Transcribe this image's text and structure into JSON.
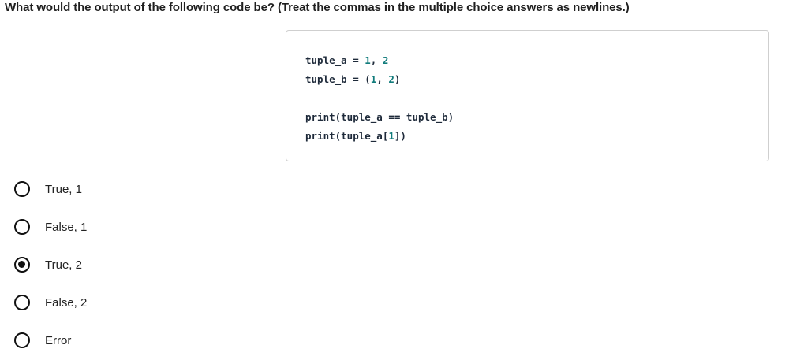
{
  "question": "What would the output of the following code be? (Treat the commas in the multiple choice answers as newlines.)",
  "code_lines": [
    [
      {
        "t": "tuple_a = ",
        "k": "text"
      },
      {
        "t": "1",
        "k": "num"
      },
      {
        "t": ", ",
        "k": "text"
      },
      {
        "t": "2",
        "k": "num"
      }
    ],
    [
      {
        "t": "tuple_b = (",
        "k": "text"
      },
      {
        "t": "1",
        "k": "num"
      },
      {
        "t": ", ",
        "k": "text"
      },
      {
        "t": "2",
        "k": "num"
      },
      {
        "t": ")",
        "k": "text"
      }
    ],
    [],
    [
      {
        "t": "print(tuple_a == tuple_b)",
        "k": "text"
      }
    ],
    [
      {
        "t": "print(tuple_a[",
        "k": "text"
      },
      {
        "t": "1",
        "k": "num"
      },
      {
        "t": "])",
        "k": "text"
      }
    ]
  ],
  "options": [
    {
      "label": "True, 1",
      "selected": false
    },
    {
      "label": "False, 1",
      "selected": false
    },
    {
      "label": "True, 2",
      "selected": true
    },
    {
      "label": "False, 2",
      "selected": false
    },
    {
      "label": "Error",
      "selected": false
    }
  ],
  "colors": {
    "number": "#127c7c",
    "code_text": "#1e2a3a"
  }
}
